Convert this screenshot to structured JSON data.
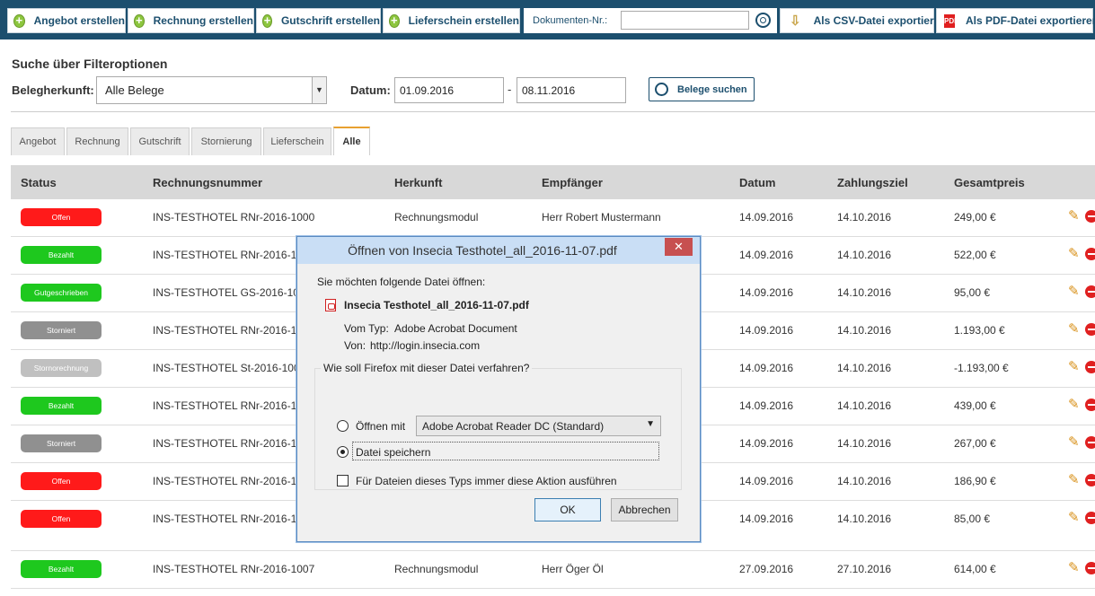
{
  "toolbar": {
    "buttons": [
      "Angebot erstellen",
      "Rechnung erstellen",
      "Gutschrift erstellen",
      "Lieferschein erstellen"
    ],
    "doc_label": "Dokumenten-Nr.:",
    "doc_value": "",
    "csv_label": "Als CSV-Datei exportieren",
    "pdf_label": "Als PDF-Datei exportieren",
    "pdf_icon_text": "PDF"
  },
  "filter": {
    "title": "Suche über Filteroptionen",
    "origin_label": "Belegherkunft:",
    "origin_value": "Alle Belege",
    "date_label": "Datum:",
    "date_from": "01.09.2016",
    "date_separator": "-",
    "date_to": "08.11.2016",
    "search_button": "Belege suchen"
  },
  "tabs": [
    "Angebot",
    "Rechnung",
    "Gutschrift",
    "Stornierung",
    "Lieferschein",
    "Alle"
  ],
  "active_tab": "Alle",
  "table": {
    "headers": [
      "Status",
      "Rechnungsnummer",
      "Herkunft",
      "Empfänger",
      "Datum",
      "Zahlungsziel",
      "Gesamtpreis"
    ],
    "rows": [
      {
        "status": "Offen",
        "color": "#ff1a1a",
        "number": "INS-TESTHOTEL RNr-2016-1000",
        "origin": "Rechnungsmodul",
        "recipient": "Herr Robert Mustermann",
        "date": "14.09.2016",
        "due": "14.10.2016",
        "total": "249,00 €"
      },
      {
        "status": "Bezahlt",
        "color": "#1ec81e",
        "number": "INS-TESTHOTEL RNr-2016-1",
        "origin": "",
        "recipient": "",
        "date": "14.09.2016",
        "due": "14.10.2016",
        "total": "522,00 €"
      },
      {
        "status": "Gutgeschrieben",
        "color": "#1ec81e",
        "number": "INS-TESTHOTEL GS-2016-10",
        "origin": "",
        "recipient": "",
        "date": "14.09.2016",
        "due": "14.10.2016",
        "total": "95,00 €"
      },
      {
        "status": "Storniert",
        "color": "#909090",
        "number": "INS-TESTHOTEL RNr-2016-1",
        "origin": "",
        "recipient": "",
        "date": "14.09.2016",
        "due": "14.10.2016",
        "total": "1.193,00 €"
      },
      {
        "status": "Stornorechnung",
        "color": "#c0c0c0",
        "number": "INS-TESTHOTEL St-2016-100",
        "origin": "",
        "recipient": "",
        "date": "14.09.2016",
        "due": "14.10.2016",
        "total": "-1.193,00 €"
      },
      {
        "status": "Bezahlt",
        "color": "#1ec81e",
        "number": "INS-TESTHOTEL RNr-2016-1",
        "origin": "",
        "recipient": "",
        "date": "14.09.2016",
        "due": "14.10.2016",
        "total": "439,00 €"
      },
      {
        "status": "Storniert",
        "color": "#909090",
        "number": "INS-TESTHOTEL RNr-2016-1",
        "origin": "",
        "recipient": "",
        "date": "14.09.2016",
        "due": "14.10.2016",
        "total": "267,00 €"
      },
      {
        "status": "Offen",
        "color": "#ff1a1a",
        "number": "INS-TESTHOTEL RNr-2016-1",
        "origin": "",
        "recipient": "",
        "date": "14.09.2016",
        "due": "14.10.2016",
        "total": "186,90 €"
      },
      {
        "status": "Offen",
        "color": "#ff1a1a",
        "number": "INS-TESTHOTEL RNr-2016-1",
        "origin": "",
        "recipient": "",
        "date": "14.09.2016",
        "due": "14.10.2016",
        "total": "85,00 €"
      },
      {
        "status": "Bezahlt",
        "color": "#1ec81e",
        "number": "INS-TESTHOTEL RNr-2016-1007",
        "origin": "Rechnungsmodul",
        "recipient": "Herr Öger Öl",
        "date": "27.09.2016",
        "due": "27.10.2016",
        "total": "614,00 €"
      }
    ]
  },
  "dialog": {
    "title": "Öffnen von Insecia Testhotel_all_2016-11-07.pdf",
    "close": "✕",
    "intro": "Sie möchten folgende Datei öffnen:",
    "filename": "Insecia Testhotel_all_2016-11-07.pdf",
    "type_label": "Vom Typ:",
    "type_value": "Adobe Acrobat Document",
    "from_label": "Von:",
    "from_value": "http://login.insecia.com",
    "question": "Wie soll Firefox mit dieser Datei verfahren?",
    "open_with": "Öffnen mit",
    "app": "Adobe Acrobat Reader DC  (Standard)",
    "save": "Datei speichern",
    "always": "Für Dateien dieses Typs immer diese Aktion ausführen",
    "ok": "OK",
    "cancel": "Abbrechen"
  }
}
